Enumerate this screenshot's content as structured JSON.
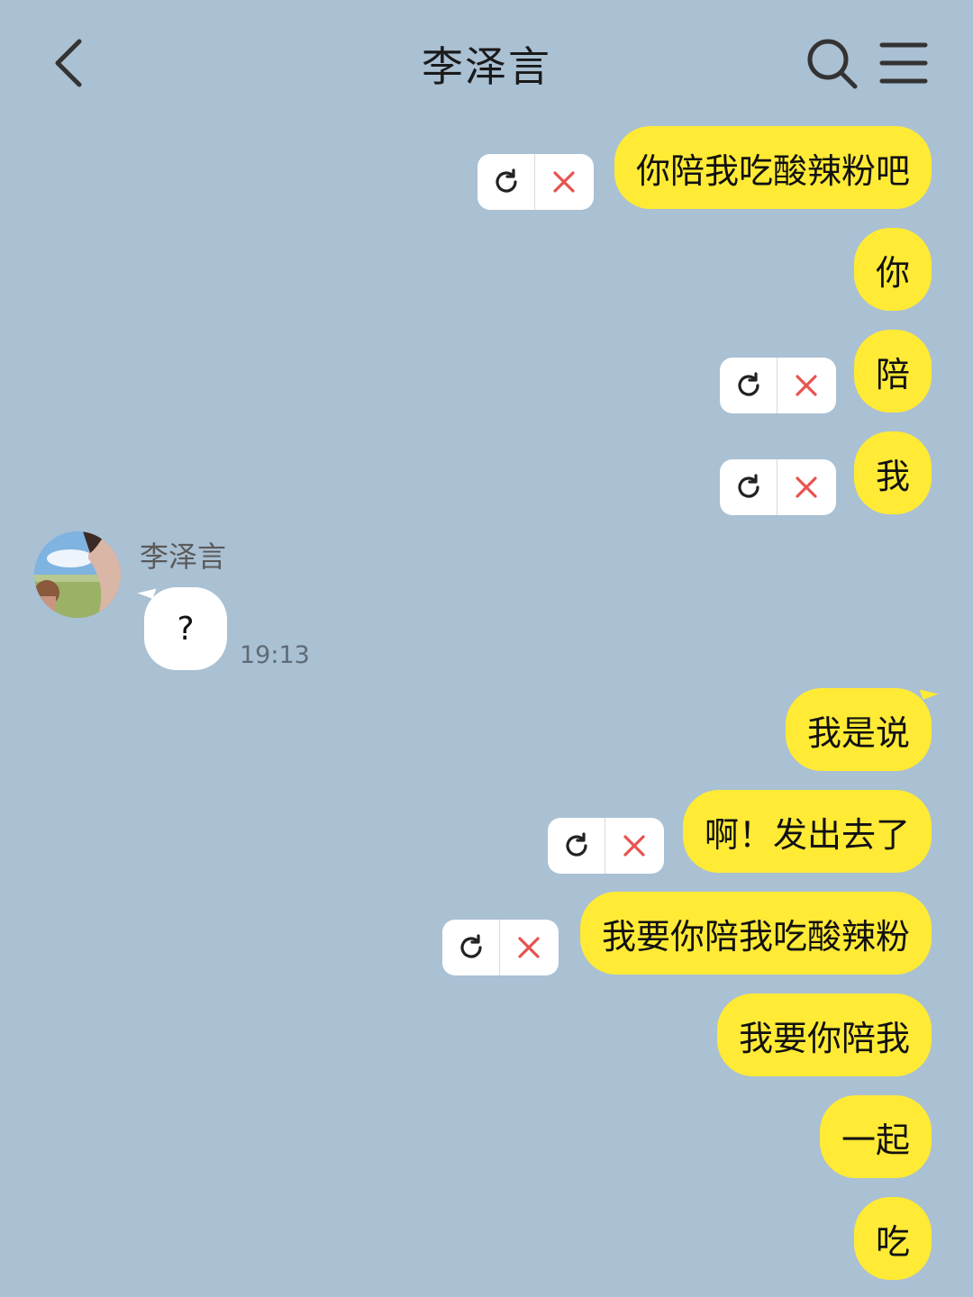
{
  "header": {
    "title": "李泽言",
    "back_icon": "chevron-left-icon",
    "search_icon": "search-icon",
    "menu_icon": "hamburger-menu-icon"
  },
  "colors": {
    "background": "#aac0d3",
    "my_bubble": "#ffea35",
    "their_bubble": "#ffffff",
    "retry_icon": "#222222",
    "delete_icon": "#e8534f"
  },
  "messages_before": [
    {
      "sender": "me",
      "text": "你陪我吃酸辣粉吧",
      "failed": true
    },
    {
      "sender": "me",
      "text": "你",
      "failed": false
    },
    {
      "sender": "me",
      "text": "陪",
      "failed": true
    },
    {
      "sender": "me",
      "text": "我",
      "failed": true
    }
  ],
  "incoming": {
    "sender_name": "李泽言",
    "text": "?",
    "time": "19:13"
  },
  "messages_after": [
    {
      "sender": "me",
      "text": "我是说",
      "failed": false
    },
    {
      "sender": "me",
      "text": "啊！发出去了",
      "failed": true
    },
    {
      "sender": "me",
      "text": "我要你陪我吃酸辣粉",
      "failed": true
    },
    {
      "sender": "me",
      "text": "我要你陪我",
      "failed": false
    },
    {
      "sender": "me",
      "text": "一起",
      "failed": false
    },
    {
      "sender": "me",
      "text": "吃",
      "failed": false
    }
  ]
}
